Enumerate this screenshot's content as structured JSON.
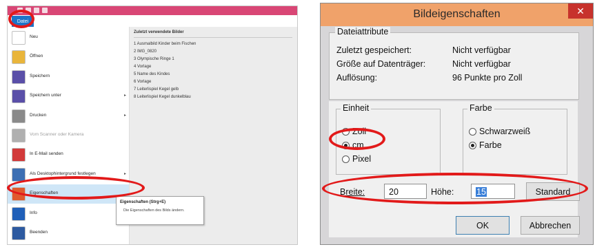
{
  "paint": {
    "file_tab": "Datei",
    "menu": [
      {
        "label": "Neu",
        "icon": "new-file-icon",
        "color": "#ffffff",
        "arrow": false
      },
      {
        "label": "Öffnen",
        "icon": "open-folder-icon",
        "color": "#e9b53b",
        "arrow": false
      },
      {
        "label": "Speichern",
        "icon": "save-disk-icon",
        "color": "#5a4fa8",
        "arrow": false
      },
      {
        "label": "Speichern unter",
        "icon": "save-as-icon",
        "color": "#5a4fa8",
        "arrow": true
      },
      {
        "label": "Drucken",
        "icon": "printer-icon",
        "color": "#8a8a8a",
        "arrow": true
      },
      {
        "label": "Vom Scanner oder Kamera",
        "icon": "scanner-icon",
        "color": "#b0b0b0",
        "arrow": false,
        "disabled": true
      },
      {
        "label": "In E-Mail senden",
        "icon": "email-icon",
        "color": "#d23a3a",
        "arrow": false
      },
      {
        "label": "Als Desktophintergrund festlegen",
        "icon": "desktop-background-icon",
        "color": "#3d6fb3",
        "arrow": true
      },
      {
        "label": "Eigenschaften",
        "icon": "checkmark-icon",
        "color": "#e05a2e",
        "arrow": false,
        "selected": true
      },
      {
        "label": "Info",
        "icon": "info-icon",
        "color": "#1f5fb8",
        "arrow": false
      },
      {
        "label": "Beenden",
        "icon": "exit-icon",
        "color": "#2d5aa0",
        "arrow": false
      }
    ],
    "recent_title": "Zuletzt verwendete Bilder",
    "recent": [
      "1  Ausmalbild Kinder beim Fischen",
      "2  IMG_0820",
      "3  Olympische Ringe 1",
      "4  Vorlage",
      "5  Name des Kindes",
      "6  Vorlage",
      "7  Leiterlispiel Kegel gelb",
      "8  Leiterlispiel Kegel dunkelblau"
    ],
    "tooltip_title": "Eigenschaften (Strg+E)",
    "tooltip_body": "Die Eigenschaften des Bilds ändern."
  },
  "dialog": {
    "title": "Bildeigenschaften",
    "close_glyph": "✕",
    "attributes_title": "Dateiattribute",
    "attributes": [
      {
        "key": "Zuletzt gespeichert:",
        "value": "Nicht verfügbar"
      },
      {
        "key": "Größe auf Datenträger:",
        "value": "Nicht verfügbar"
      },
      {
        "key": "Auflösung:",
        "value": "96 Punkte pro Zoll"
      }
    ],
    "unit_title": "Einheit",
    "units": [
      {
        "label": "Zoll",
        "checked": false
      },
      {
        "label": "cm",
        "checked": true
      },
      {
        "label": "Pixel",
        "checked": false
      }
    ],
    "color_title": "Farbe",
    "colors": [
      {
        "label": "Schwarzweiß",
        "checked": false
      },
      {
        "label": "Farbe",
        "checked": true
      }
    ],
    "width_label": "Breite:",
    "width_value": "20",
    "height_label": "Höhe:",
    "height_value": "15",
    "standard_button": "Standard",
    "ok_button": "OK",
    "cancel_button": "Abbrechen"
  },
  "colors": {
    "annotation_red": "#e21a1a",
    "title_bar": "#f0a26a",
    "file_tab_blue": "#1e74c8",
    "qat_pink": "#d94675"
  }
}
